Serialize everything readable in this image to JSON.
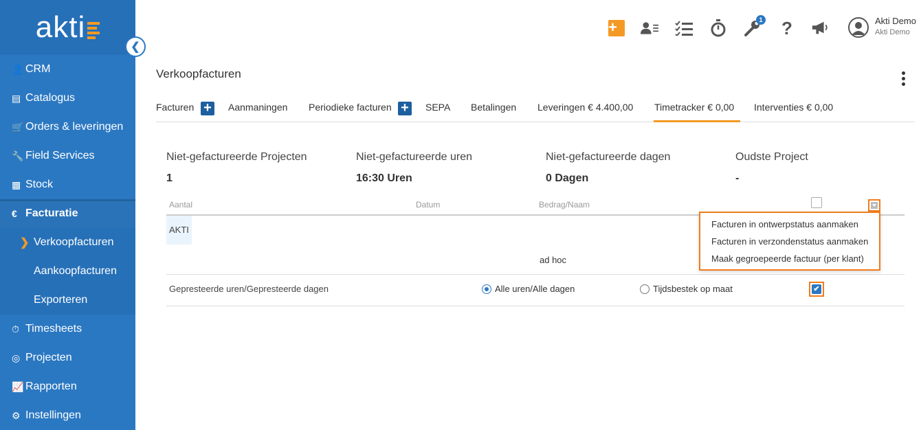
{
  "logo": {
    "text": "akti"
  },
  "sidebar": {
    "items": [
      {
        "label": "CRM",
        "icon": "user-icon"
      },
      {
        "label": "Catalogus",
        "icon": "book-icon"
      },
      {
        "label": "Orders & leveringen",
        "icon": "cart-icon"
      },
      {
        "label": "Field Services",
        "icon": "wrench-icon"
      },
      {
        "label": "Stock",
        "icon": "cubes-icon"
      },
      {
        "label": "Facturatie",
        "icon": "euro-icon",
        "active": true
      },
      {
        "label": "Timesheets",
        "icon": "stopwatch-icon"
      },
      {
        "label": "Projecten",
        "icon": "target-icon"
      },
      {
        "label": "Rapporten",
        "icon": "chart-icon"
      },
      {
        "label": "Instellingen",
        "icon": "gear-icon"
      }
    ],
    "sub_items": [
      {
        "label": "Verkoopfacturen",
        "active": true
      },
      {
        "label": "Aankoopfacturen"
      },
      {
        "label": "Exporteren"
      }
    ]
  },
  "topbar": {
    "notification_count": "1",
    "user_name": "Akti Demo",
    "user_company": "Akti Demo"
  },
  "page": {
    "title": "Verkoopfacturen"
  },
  "tabs": [
    {
      "label": "Facturen"
    },
    {
      "label": "Aanmaningen"
    },
    {
      "label": "Periodieke facturen"
    },
    {
      "label": "SEPA"
    },
    {
      "label": "Betalingen"
    },
    {
      "label": "Leveringen € 4.400,00"
    },
    {
      "label": "Timetracker € 0,00",
      "active": true
    },
    {
      "label": "Interventies € 0,00"
    }
  ],
  "stats": [
    {
      "label": "Niet-gefactureerde Projecten",
      "value": "1"
    },
    {
      "label": "Niet-gefactureerde uren",
      "value": "16:30 Uren"
    },
    {
      "label": "Niet-gefactureerde dagen",
      "value": "0 Dagen"
    },
    {
      "label": "Oudste Project",
      "value": "-"
    }
  ],
  "table": {
    "headers": [
      "Aantal",
      "Datum",
      "Bedrag/Naam"
    ],
    "row_name": "AKTI",
    "row_amount": "ad hoc",
    "hours_label": "Gepresteerde uren/Gepresteerde dagen",
    "radio_all": "Alle uren/Alle dagen",
    "radio_custom": "Tijdsbestek op maat",
    "selected_radio": "Alle uren/Alle dagen"
  },
  "dropdown": {
    "items": [
      "Facturen in ontwerpstatus aanmaken",
      "Facturen in verzondenstatus aanmaken",
      "Maak gegroepeerde factuur (per klant)"
    ]
  },
  "colors": {
    "brand": "#2b78c2",
    "accent": "#f49a24",
    "highlight": "#f07c1c"
  }
}
